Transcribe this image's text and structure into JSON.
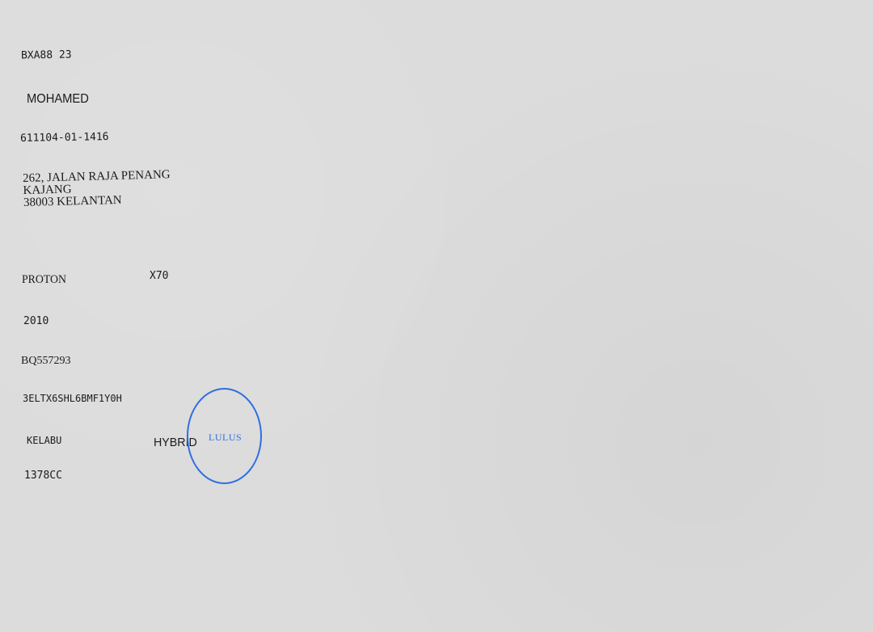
{
  "owner": {
    "plate_number": "BXA88 23",
    "name": "MOHAMED",
    "ic_number": "611104-01-1416",
    "address": {
      "line1": "262, JALAN RAJA PENANG",
      "line2": "KAJANG",
      "line3": "38003 KELANTAN"
    }
  },
  "vehicle": {
    "make": "PROTON",
    "model": "X70",
    "year": "2010",
    "engine_number": "BQ557293",
    "chassis_number": "3ELTX6SHL6BMF1Y0H",
    "color": "KELABU",
    "fuel_type": "HYBRID",
    "engine_capacity": "1378CC"
  },
  "stamp": {
    "text": "LULUS",
    "color": "#2f6fe0"
  }
}
